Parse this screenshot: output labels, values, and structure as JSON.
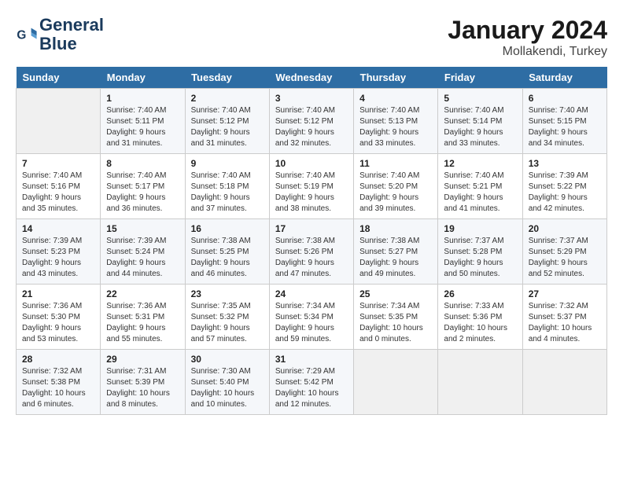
{
  "header": {
    "logo_line1": "General",
    "logo_line2": "Blue",
    "month_year": "January 2024",
    "location": "Mollakendi, Turkey"
  },
  "days_of_week": [
    "Sunday",
    "Monday",
    "Tuesday",
    "Wednesday",
    "Thursday",
    "Friday",
    "Saturday"
  ],
  "weeks": [
    [
      {
        "day": "",
        "content": ""
      },
      {
        "day": "1",
        "content": "Sunrise: 7:40 AM\nSunset: 5:11 PM\nDaylight: 9 hours\nand 31 minutes."
      },
      {
        "day": "2",
        "content": "Sunrise: 7:40 AM\nSunset: 5:12 PM\nDaylight: 9 hours\nand 31 minutes."
      },
      {
        "day": "3",
        "content": "Sunrise: 7:40 AM\nSunset: 5:12 PM\nDaylight: 9 hours\nand 32 minutes."
      },
      {
        "day": "4",
        "content": "Sunrise: 7:40 AM\nSunset: 5:13 PM\nDaylight: 9 hours\nand 33 minutes."
      },
      {
        "day": "5",
        "content": "Sunrise: 7:40 AM\nSunset: 5:14 PM\nDaylight: 9 hours\nand 33 minutes."
      },
      {
        "day": "6",
        "content": "Sunrise: 7:40 AM\nSunset: 5:15 PM\nDaylight: 9 hours\nand 34 minutes."
      }
    ],
    [
      {
        "day": "7",
        "content": "Sunrise: 7:40 AM\nSunset: 5:16 PM\nDaylight: 9 hours\nand 35 minutes."
      },
      {
        "day": "8",
        "content": "Sunrise: 7:40 AM\nSunset: 5:17 PM\nDaylight: 9 hours\nand 36 minutes."
      },
      {
        "day": "9",
        "content": "Sunrise: 7:40 AM\nSunset: 5:18 PM\nDaylight: 9 hours\nand 37 minutes."
      },
      {
        "day": "10",
        "content": "Sunrise: 7:40 AM\nSunset: 5:19 PM\nDaylight: 9 hours\nand 38 minutes."
      },
      {
        "day": "11",
        "content": "Sunrise: 7:40 AM\nSunset: 5:20 PM\nDaylight: 9 hours\nand 39 minutes."
      },
      {
        "day": "12",
        "content": "Sunrise: 7:40 AM\nSunset: 5:21 PM\nDaylight: 9 hours\nand 41 minutes."
      },
      {
        "day": "13",
        "content": "Sunrise: 7:39 AM\nSunset: 5:22 PM\nDaylight: 9 hours\nand 42 minutes."
      }
    ],
    [
      {
        "day": "14",
        "content": "Sunrise: 7:39 AM\nSunset: 5:23 PM\nDaylight: 9 hours\nand 43 minutes."
      },
      {
        "day": "15",
        "content": "Sunrise: 7:39 AM\nSunset: 5:24 PM\nDaylight: 9 hours\nand 44 minutes."
      },
      {
        "day": "16",
        "content": "Sunrise: 7:38 AM\nSunset: 5:25 PM\nDaylight: 9 hours\nand 46 minutes."
      },
      {
        "day": "17",
        "content": "Sunrise: 7:38 AM\nSunset: 5:26 PM\nDaylight: 9 hours\nand 47 minutes."
      },
      {
        "day": "18",
        "content": "Sunrise: 7:38 AM\nSunset: 5:27 PM\nDaylight: 9 hours\nand 49 minutes."
      },
      {
        "day": "19",
        "content": "Sunrise: 7:37 AM\nSunset: 5:28 PM\nDaylight: 9 hours\nand 50 minutes."
      },
      {
        "day": "20",
        "content": "Sunrise: 7:37 AM\nSunset: 5:29 PM\nDaylight: 9 hours\nand 52 minutes."
      }
    ],
    [
      {
        "day": "21",
        "content": "Sunrise: 7:36 AM\nSunset: 5:30 PM\nDaylight: 9 hours\nand 53 minutes."
      },
      {
        "day": "22",
        "content": "Sunrise: 7:36 AM\nSunset: 5:31 PM\nDaylight: 9 hours\nand 55 minutes."
      },
      {
        "day": "23",
        "content": "Sunrise: 7:35 AM\nSunset: 5:32 PM\nDaylight: 9 hours\nand 57 minutes."
      },
      {
        "day": "24",
        "content": "Sunrise: 7:34 AM\nSunset: 5:34 PM\nDaylight: 9 hours\nand 59 minutes."
      },
      {
        "day": "25",
        "content": "Sunrise: 7:34 AM\nSunset: 5:35 PM\nDaylight: 10 hours\nand 0 minutes."
      },
      {
        "day": "26",
        "content": "Sunrise: 7:33 AM\nSunset: 5:36 PM\nDaylight: 10 hours\nand 2 minutes."
      },
      {
        "day": "27",
        "content": "Sunrise: 7:32 AM\nSunset: 5:37 PM\nDaylight: 10 hours\nand 4 minutes."
      }
    ],
    [
      {
        "day": "28",
        "content": "Sunrise: 7:32 AM\nSunset: 5:38 PM\nDaylight: 10 hours\nand 6 minutes."
      },
      {
        "day": "29",
        "content": "Sunrise: 7:31 AM\nSunset: 5:39 PM\nDaylight: 10 hours\nand 8 minutes."
      },
      {
        "day": "30",
        "content": "Sunrise: 7:30 AM\nSunset: 5:40 PM\nDaylight: 10 hours\nand 10 minutes."
      },
      {
        "day": "31",
        "content": "Sunrise: 7:29 AM\nSunset: 5:42 PM\nDaylight: 10 hours\nand 12 minutes."
      },
      {
        "day": "",
        "content": ""
      },
      {
        "day": "",
        "content": ""
      },
      {
        "day": "",
        "content": ""
      }
    ]
  ]
}
